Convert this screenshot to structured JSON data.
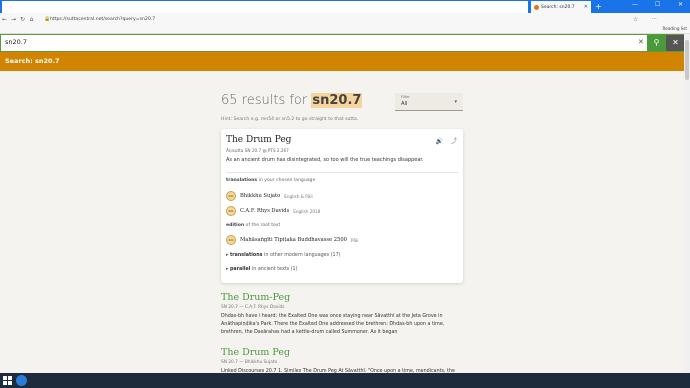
{
  "browser": {
    "tab_title": "Search: sn20.7",
    "tab_close": "✕",
    "new_tab": "+",
    "url": "https://suttacentral.net/search?query=sn20.7",
    "reading_list": "Reading list",
    "win_min": "—",
    "win_max": "☐",
    "win_close": "✕"
  },
  "search": {
    "value": "sn20.7",
    "clear_glyph": "✕",
    "search_glyph": "⚲",
    "close_glyph": "✕"
  },
  "header": {
    "title": "Search: sn20.7"
  },
  "results": {
    "count_text": "65 results for ",
    "query": "sn20.7",
    "filter_label": "Filter",
    "filter_value": "All",
    "hint": "Hint: Search e.g. mn54 or sn5.2 to go straight to that sutta."
  },
  "card": {
    "title": "The Drum Peg",
    "meta": "Āṇisutta    SN 20.7    ▤ PTS 2.267",
    "description": "As an ancient drum has disintegrated, so too will the true teachings disappear.",
    "translations_label": "translations",
    "translations_suffix": " in your chosen language",
    "translations": [
      {
        "name": "Bhikkhu Sujato",
        "lang": "English & Pāli",
        "badge": "ᨑᨑ"
      },
      {
        "name": "C.A.F. Rhys Davids",
        "lang": "English 2018",
        "badge": "ᨑᨑ"
      }
    ],
    "edition_label": "edition",
    "edition_suffix": " of the root text",
    "edition": {
      "name": "Mahāsaṅgīti Tipiṭaka Buddhavasse 2500",
      "lang": "Pāli",
      "badge": "ᨑᨑ"
    },
    "other_label": "translations",
    "other_suffix": " in other modern languages ",
    "other_count": "(17)",
    "parallel_label": "parallel",
    "parallel_suffix": " in ancient texts ",
    "parallel_count": "(1)"
  },
  "result_items": [
    {
      "title": "The Drum-Peg",
      "sub": "SN 20.7 — C.A.F. Rhys Davids",
      "text": "Dhdas-bh have i heard: the Exalted One was once staying near Sāvatthī at the Jeta Grove in Anāthapiṇḍika's Park. There the Exalted One addressed the brethren: Dhdas-bh upon a time, brethren, the Dasārahas had a kettle-drum called Summoner. As it began"
    },
    {
      "title": "The Drum Peg",
      "sub": "SN 20.7 — Bhikkhu Sujato",
      "text": "Linked Discourses 20.7 1. Similes The Drum Peg At Sāvatthī. \"Once upon a time, mendicants, the"
    }
  ],
  "colors": {
    "accent": "#d08400",
    "green": "#4a9a3c",
    "tabbar": "#1a73e8"
  }
}
